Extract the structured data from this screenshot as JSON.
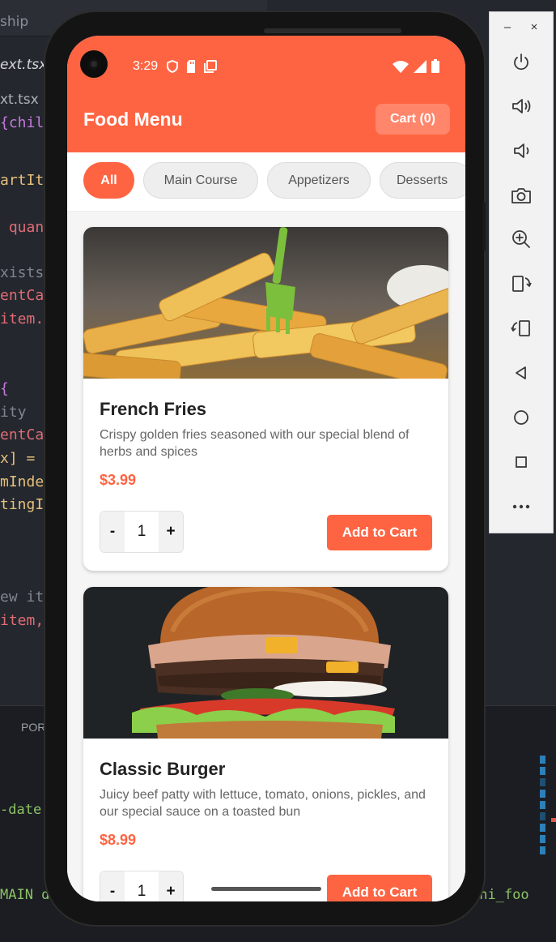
{
  "editor": {
    "tab_title": "ship",
    "file_tab": "ext.tsx",
    "breadcrumb": "xt.tsx",
    "code_lines": [
      {
        "text": "{chil",
        "color": "#c678dd"
      },
      {
        "text": "artIt",
        "color": "#e5c07b"
      },
      {
        "text": " quan",
        "color": "#e06c75"
      },
      {
        "text": "xists",
        "color": "#7f848e"
      },
      {
        "text": "entCa",
        "color": "#e06c75"
      },
      {
        "text": "item.",
        "color": "#e06c75"
      },
      {
        "text": "{",
        "color": "#c678dd"
      },
      {
        "text": "ity",
        "color": "#7f848e"
      },
      {
        "text": "entCa",
        "color": "#e06c75"
      },
      {
        "text": "x] = ",
        "color": "#e5c07b"
      },
      {
        "text": "mInde",
        "color": "#e5c07b"
      },
      {
        "text": "tingI",
        "color": "#e5c07b"
      },
      {
        "text": "ew it",
        "color": "#7f848e"
      },
      {
        "text": "item,",
        "color": "#e06c75"
      }
    ],
    "terminal_tab": "POR",
    "terminal_lines": [
      "-date",
      "MAIN d",
      "ini_foo"
    ]
  },
  "emulator": {
    "minimize_label": "–",
    "close_label": "×",
    "tools": [
      "power-icon",
      "volume-up-icon",
      "volume-down-icon",
      "camera-icon",
      "zoom-in-icon",
      "rotate-left-icon",
      "rotate-right-icon",
      "back-icon",
      "home-icon",
      "overview-icon",
      "more-icon"
    ]
  },
  "status_bar": {
    "time": "3:29"
  },
  "header": {
    "title": "Food Menu",
    "cart_label": "Cart (0)"
  },
  "categories": [
    "All",
    "Main Course",
    "Appetizers",
    "Desserts"
  ],
  "selected_category": "All",
  "menu_items": [
    {
      "name": "French Fries",
      "description": "Crispy golden fries seasoned with our special blend of herbs and spices",
      "price": "$3.99",
      "quantity": "1",
      "decrement_label": "-",
      "increment_label": "+",
      "add_label": "Add to Cart"
    },
    {
      "name": "Classic Burger",
      "description": "Juicy beef patty with lettuce, tomato, onions, pickles, and our special sauce on a toasted bun",
      "price": "$8.99",
      "quantity": "1",
      "decrement_label": "-",
      "increment_label": "+",
      "add_label": "Add to Cart"
    }
  ],
  "colors": {
    "brand": "#ff6442",
    "price": "#ff6442"
  }
}
